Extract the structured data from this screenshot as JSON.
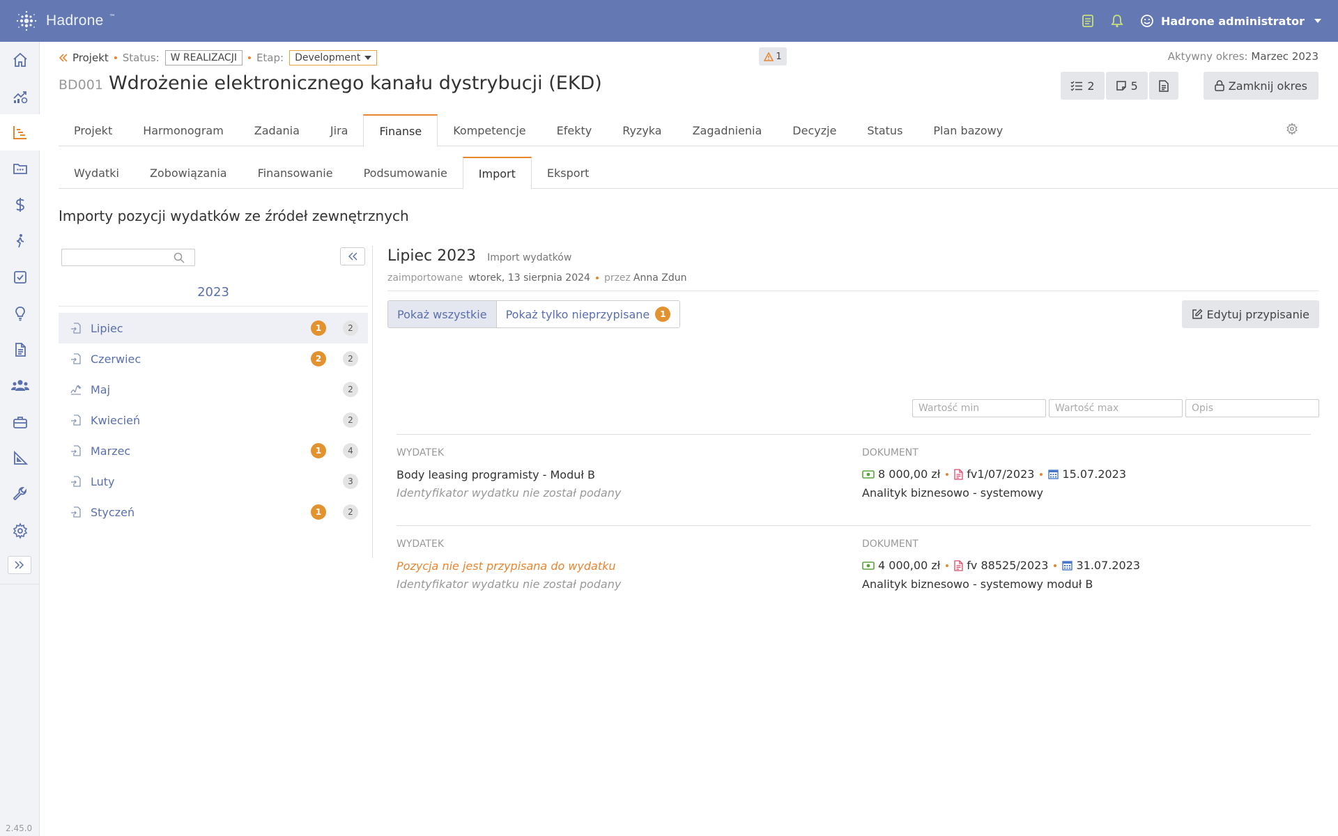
{
  "app": {
    "name": "Hadrone",
    "version": "2.45.0"
  },
  "user": {
    "name": "Hadrone administrator"
  },
  "project": {
    "breadcrumb_label": "Projekt",
    "status_label": "Status:",
    "status_value": "W REALIZACJI",
    "stage_label": "Etap:",
    "stage_value": "Development",
    "warnings_count": "1",
    "active_period_label": "Aktywny okres:",
    "active_period_value": "Marzec 2023",
    "code": "BD001",
    "title": "Wdrożenie elektronicznego kanału dystrybucji (EKD)"
  },
  "actions": {
    "tasks_count": "2",
    "notes_count": "5",
    "close_period_label": "Zamknij okres"
  },
  "tabs": [
    {
      "label": "Projekt",
      "active": false
    },
    {
      "label": "Harmonogram",
      "active": false
    },
    {
      "label": "Zadania",
      "active": false
    },
    {
      "label": "Jira",
      "active": false
    },
    {
      "label": "Finanse",
      "active": true
    },
    {
      "label": "Kompetencje",
      "active": false
    },
    {
      "label": "Efekty",
      "active": false
    },
    {
      "label": "Ryzyka",
      "active": false
    },
    {
      "label": "Zagadnienia",
      "active": false
    },
    {
      "label": "Decyzje",
      "active": false
    },
    {
      "label": "Status",
      "active": false
    },
    {
      "label": "Plan bazowy",
      "active": false
    }
  ],
  "subtabs": [
    {
      "label": "Wydatki",
      "active": false
    },
    {
      "label": "Zobowiązania",
      "active": false
    },
    {
      "label": "Finansowanie",
      "active": false
    },
    {
      "label": "Podsumowanie",
      "active": false
    },
    {
      "label": "Import",
      "active": true
    },
    {
      "label": "Eksport",
      "active": false
    }
  ],
  "section_title": "Importy pozycji wydatków ze źródeł zewnętrznych",
  "imports": {
    "year": "2023",
    "months": [
      {
        "label": "Lipiec",
        "unassigned": "1",
        "total": "2",
        "icon": "import-file-icon",
        "active": true
      },
      {
        "label": "Czerwiec",
        "unassigned": "2",
        "total": "2",
        "icon": "import-file-icon",
        "active": false
      },
      {
        "label": "Maj",
        "unassigned": "",
        "total": "2",
        "icon": "sign-icon",
        "active": false
      },
      {
        "label": "Kwiecień",
        "unassigned": "",
        "total": "2",
        "icon": "import-file-icon",
        "active": false
      },
      {
        "label": "Marzec",
        "unassigned": "1",
        "total": "4",
        "icon": "import-file-icon",
        "active": false
      },
      {
        "label": "Luty",
        "unassigned": "",
        "total": "3",
        "icon": "import-file-icon",
        "active": false
      },
      {
        "label": "Styczeń",
        "unassigned": "1",
        "total": "2",
        "icon": "import-file-icon",
        "active": false
      }
    ]
  },
  "detail": {
    "title": "Lipiec 2023",
    "subtitle": "Import wydatków",
    "imported_label": "zaimportowane",
    "imported_date": "wtorek, 13 sierpnia 2024",
    "by_label": "przez",
    "by_user": "Anna Zdun",
    "show_all_label": "Pokaż wszystkie",
    "show_unassigned_label": "Pokaż tylko nieprzypisane",
    "unassigned_count": "1",
    "edit_assignment_label": "Edytuj przypisanie",
    "filter_min_placeholder": "Wartość min",
    "filter_max_placeholder": "Wartość max",
    "filter_desc_placeholder": "Opis",
    "entries": [
      {
        "expense_header": "WYDATEK",
        "expense_text": "Body leasing programisty - Moduł B",
        "expense_unassigned": false,
        "expense_id_text": "Identyfikator wydatku nie został podany",
        "doc_header": "DOKUMENT",
        "amount": "8 000,00 zł",
        "doc_number": "fv1/07/2023",
        "date": "15.07.2023",
        "doc_desc": "Analityk biznesowo - systemowy"
      },
      {
        "expense_header": "WYDATEK",
        "expense_text": "Pozycja nie jest przypisana do wydatku",
        "expense_unassigned": true,
        "expense_id_text": "Identyfikator wydatku nie został podany",
        "doc_header": "DOKUMENT",
        "amount": "4 000,00 zł",
        "doc_number": "fv 88525/2023",
        "date": "31.07.2023",
        "doc_desc": "Analityk biznesowo - systemowy moduł B"
      }
    ]
  },
  "colors": {
    "topbar": "#6478b4",
    "accent": "#e8862f",
    "link": "#5a6fad",
    "badge_orange": "#e2922f"
  }
}
